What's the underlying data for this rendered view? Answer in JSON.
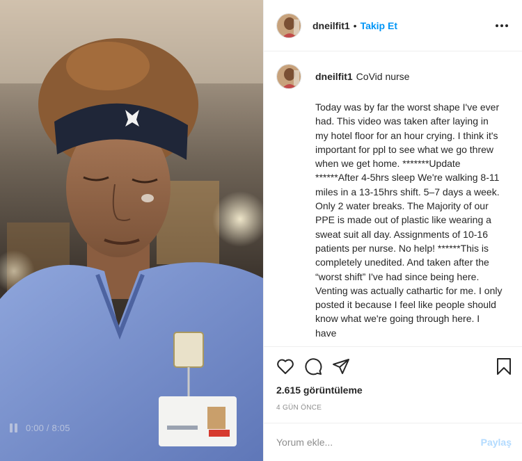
{
  "video": {
    "time": "0:00 / 8:05",
    "controls_icon": "pause-icon"
  },
  "header": {
    "username": "dneilfit1",
    "separator": "•",
    "follow_label": "Takip Et",
    "more_icon": "more-horizontal-icon"
  },
  "caption": {
    "username": "dneilfit1",
    "subtitle": "CoVid nurse",
    "text": "Today was by far the worst shape I've ever had. This video was taken after laying in my hotel floor for an hour crying. I think it's important for ppl to see what we go threw when we get home. *******Update ******After 4-5hrs sleep We're walking 8-11 miles in a 13-15hrs shift. 5–7 days a week. Only 2 water breaks. The Majority of our PPE is made out of plastic like wearing a sweat suit all day. Assignments of 10-16 patients per nurse. No help! ******This is completely unedited. And taken after the “worst shift” I've had since being here. Venting was actually cathartic for me. I only posted it because I feel like people should know what we're going through here. I have"
  },
  "actions": {
    "icons": [
      "heart-icon",
      "comment-icon",
      "share-icon",
      "bookmark-icon"
    ],
    "views": "2.615 görüntüleme",
    "date": "4 GÜN ÖNCE"
  },
  "comment": {
    "placeholder": "Yorum ekle...",
    "post_label": "Paylaş"
  },
  "colors": {
    "accent": "#0095f6",
    "post_disabled": "#b3dbff",
    "text": "#262626",
    "muted": "#8e8e8e"
  }
}
